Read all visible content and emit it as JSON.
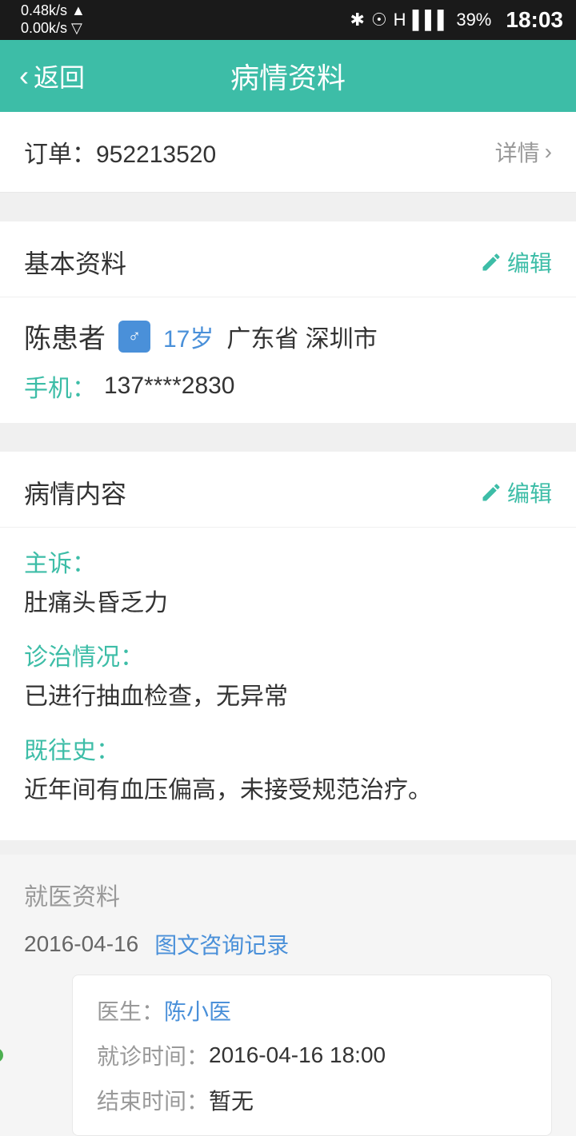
{
  "statusBar": {
    "speed": "0.48k/s ▲",
    "speedDown": "0.00k/s ▽",
    "battery": "39%",
    "time": "18:03"
  },
  "nav": {
    "backLabel": "返回",
    "title": "病情资料"
  },
  "order": {
    "label": "订单：952213520",
    "detailLabel": "详情"
  },
  "basicInfo": {
    "sectionTitle": "基本资料",
    "editLabel": "编辑",
    "patientName": "陈患者",
    "gender": "♂",
    "age": "17岁",
    "location": "广东省 深圳市",
    "phoneLabel": "手机：",
    "phoneNumber": "137****2830"
  },
  "medicalContent": {
    "sectionTitle": "病情内容",
    "editLabel": "编辑",
    "chiefComplaintLabel": "主诉：",
    "chiefComplaintText": "肚痛头昏乏力",
    "diagnosisLabel": "诊治情况：",
    "diagnosisText": "已进行抽血检查，无异常",
    "historyLabel": "既往史：",
    "historyText": "近年间有血压偏高，未接受规范治疗。"
  },
  "medicalRecords": {
    "sectionTitle": "就医资料",
    "date": "2016-04-16",
    "recordType": "图文咨询记录",
    "doctorLabel": "医生：",
    "doctorName": "陈小医",
    "visitTimeLabel": "就诊时间：",
    "visitTime": "2016-04-16 18:00",
    "endTimeLabel": "结束时间：",
    "endTime": "暂无"
  }
}
